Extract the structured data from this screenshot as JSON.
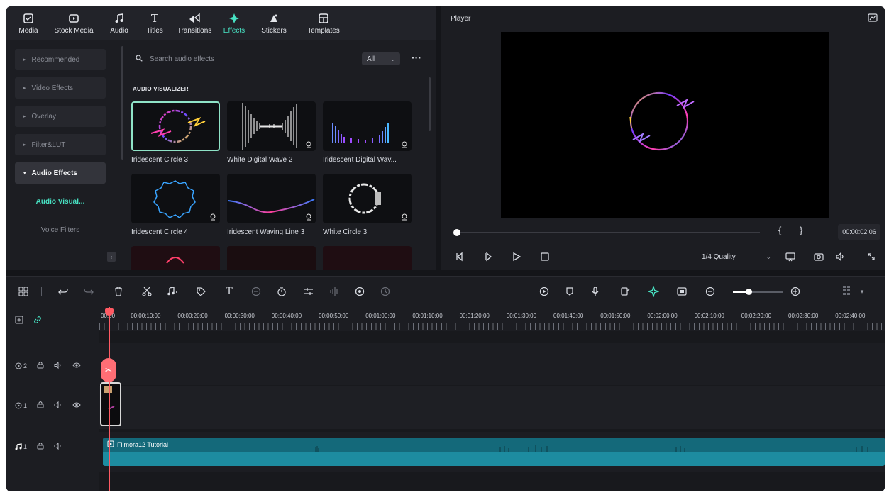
{
  "library": {
    "tabs": [
      {
        "label": "Media",
        "icon": "media-icon"
      },
      {
        "label": "Stock Media",
        "icon": "stock-media-icon"
      },
      {
        "label": "Audio",
        "icon": "music-note-icon"
      },
      {
        "label": "Titles",
        "icon": "text-t-icon"
      },
      {
        "label": "Transitions",
        "icon": "transition-icon"
      },
      {
        "label": "Effects",
        "icon": "effects-sparkle-icon",
        "active": true
      },
      {
        "label": "Stickers",
        "icon": "sticker-icon"
      },
      {
        "label": "Templates",
        "icon": "template-icon"
      }
    ],
    "nav": [
      {
        "label": "Recommended"
      },
      {
        "label": "Video Effects"
      },
      {
        "label": "Overlay"
      },
      {
        "label": "Filter&LUT"
      },
      {
        "label": "Audio Effects",
        "open": true
      }
    ],
    "subnav": [
      {
        "label": "Audio Visual...",
        "active": true
      },
      {
        "label": "Voice Filters"
      }
    ],
    "search_placeholder": "Search audio effects",
    "filter_value": "All",
    "section_title": "AUDIO VISUALIZER",
    "cards": [
      {
        "label": "Iridescent Circle 3"
      },
      {
        "label": "White  Digital Wave 2"
      },
      {
        "label": "Iridescent Digital Wav..."
      },
      {
        "label": "Iridescent Circle 4"
      },
      {
        "label": "Iridescent Waving Line 3"
      },
      {
        "label": "White Circle 3"
      }
    ]
  },
  "player": {
    "title": "Player",
    "timecode": "00:00:02:06",
    "quality": "1/4 Quality",
    "bracket_in": "{",
    "bracket_out": "}"
  },
  "timeline": {
    "ruler_labels": [
      "00:00",
      "00:00:10:00",
      "00:00:20:00",
      "00:00:30:00",
      "00:00:40:00",
      "00:00:50:00",
      "00:01:00:00",
      "00:01:10:00",
      "00:01:20:00",
      "00:01:30:00",
      "00:01:40:00",
      "00:01:50:00",
      "00:02:00:00",
      "00:02:10:00",
      "00:02:20:00",
      "00:02:30:00",
      "00:02:40:00"
    ],
    "tracks": [
      {
        "index": "2"
      },
      {
        "index": "1"
      },
      {
        "index": "1"
      }
    ],
    "audio_clip_label": "Filmora12 Tutorial"
  },
  "colors": {
    "accent": "#48e3c4",
    "playhead": "#ff5a63",
    "audio_clip": "#1d8ca0"
  }
}
